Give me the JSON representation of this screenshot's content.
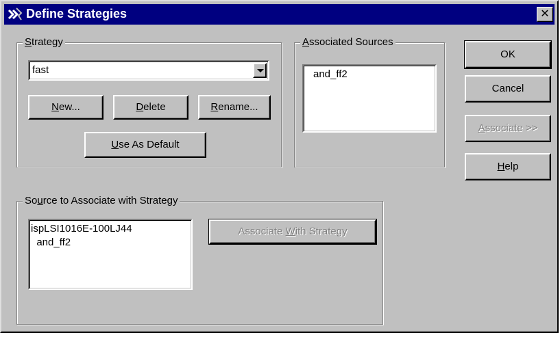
{
  "window": {
    "title": "Define Strategies",
    "close_label": "✕"
  },
  "strategy_group": {
    "legend_before": "",
    "legend_mnemonic": "S",
    "legend_after": "trategy",
    "selected": "fast",
    "new_mn": "N",
    "new_rest": "ew...",
    "delete_mn": "D",
    "delete_rest": "elete",
    "rename_mn": "R",
    "rename_rest": "ename...",
    "default_mn": "U",
    "default_rest": "se As Default"
  },
  "associated_sources_group": {
    "legend_mn": "A",
    "legend_rest": "ssociated Sources",
    "items": [
      "and_ff2"
    ]
  },
  "actions": {
    "ok": "OK",
    "cancel": "Cancel",
    "associate_mn": "A",
    "associate_rest": "ssociate >>",
    "help_mn": "H",
    "help_rest": "elp"
  },
  "source_group": {
    "legend_before": "So",
    "legend_mn": "u",
    "legend_after": "rce to Associate with Strategy",
    "items": [
      "ispLSI1016E-100LJ44",
      "  and_ff2"
    ],
    "associate_before": "Associate ",
    "associate_mn": "W",
    "associate_after": "ith Strategy"
  }
}
